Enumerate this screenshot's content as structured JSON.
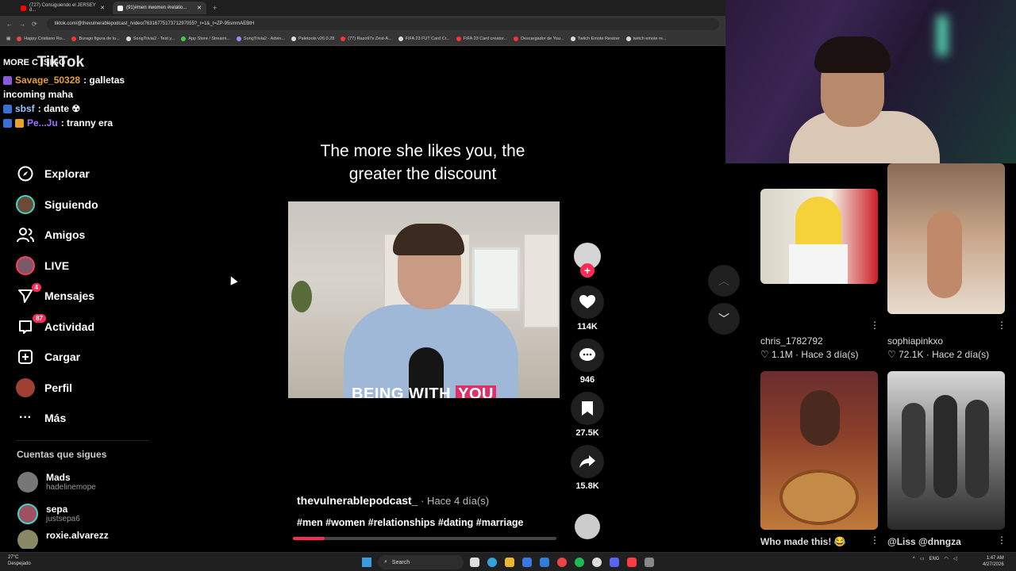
{
  "browser": {
    "tabs": [
      {
        "label": "(727) Consiguiendo el JERSEY d...",
        "color": "#ff0000"
      },
      {
        "label": "(91)#men #women #relatio...",
        "color": "#ffffff"
      }
    ],
    "url": "tiktok.com/@thevulnerablepodcast_/video/7631677517371297055?_r=1&_t=ZP-95smmAEBtH",
    "bookmarks": [
      "Happy Cristiano Ro...",
      "Burago figura de to...",
      "SongTrivia2 - Test y...",
      "App Store / Streami...",
      "SongTrivia2 - Advin...",
      "Paletools v26.0.28",
      "(77) Razo97s Zest-A...",
      "FIFA 23 FUT Card Cr...",
      "FIFA 23 Card creator...",
      "Descargador de You...",
      "Twitch Emote Resizer",
      "twitch emote re..."
    ]
  },
  "chat": {
    "lines": [
      {
        "user": "MORE C",
        "text": "ISIGO",
        "logo": "TikTok"
      },
      {
        "user": "Savage_50328",
        "text": ": galletas",
        "color": "#e8a030"
      },
      {
        "user": "",
        "text": "incoming maha",
        "color": "#ffffff"
      },
      {
        "user": "sbsf",
        "text": ": dante ☢",
        "color": "#9fc8ff"
      },
      {
        "user": "Pe...Ju",
        "text": ": tranny era",
        "color": "#a070ff"
      }
    ]
  },
  "sidebar": {
    "items": [
      {
        "label": "Explorar",
        "icon": "compass-icon"
      },
      {
        "label": "Siguiendo",
        "icon": "avatar"
      },
      {
        "label": "Amigos",
        "icon": "friends-icon"
      },
      {
        "label": "LIVE",
        "icon": "live-avatar"
      },
      {
        "label": "Mensajes",
        "icon": "send-icon",
        "badge": "4"
      },
      {
        "label": "Actividad",
        "icon": "inbox-icon",
        "badge": "87"
      },
      {
        "label": "Cargar",
        "icon": "plus-square-icon"
      },
      {
        "label": "Perfil",
        "icon": "profile-avatar"
      },
      {
        "label": "Más",
        "icon": "more-icon"
      }
    ],
    "following_title": "Cuentas que sigues",
    "accounts": [
      {
        "name": "Mads",
        "handle": "hadelinemope"
      },
      {
        "name": "sepa",
        "handle": "justsepa6"
      },
      {
        "name": "roxie.alvarezz",
        "handle": ""
      }
    ]
  },
  "video": {
    "top_caption": "The more she likes you, the greater the discount",
    "subtitle_plain": "BEING WITH",
    "subtitle_highlight": "YOU",
    "author": "thevulnerablepodcast_",
    "time": " · Hace 4 día(s)",
    "hashtags": "#men #women #relationships #dating #marriage",
    "progress": 0.12,
    "likes": "114K",
    "comments": "946",
    "saves": "27.5K",
    "shares": "15.8K",
    "accent": "#fe2c55"
  },
  "grid": [
    {
      "name": "chris_1782792",
      "meta": "♡ 1.1M · Hace 3 día(s)"
    },
    {
      "name": "sophiapinkxo",
      "meta": "♡ 72.1K · Hace 2 día(s)"
    },
    {
      "name": "Who made this! 😂",
      "meta": ""
    },
    {
      "name": "@Liss @dnngza",
      "meta": ""
    }
  ],
  "taskbar": {
    "weather_temp": "27°C",
    "weather_desc": "Despejado",
    "search": "Search",
    "lang": "ENG",
    "time": "1:47 AM",
    "date": "4/27/2026"
  }
}
